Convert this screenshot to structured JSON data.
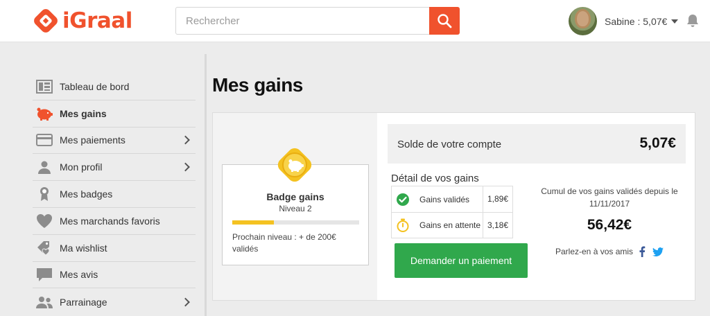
{
  "header": {
    "logo_text": "iGraal",
    "search_placeholder": "Rechercher",
    "user_label": "Sabine : 5,07€"
  },
  "sidebar": {
    "items": [
      {
        "label": "Tableau de bord",
        "icon": "dashboard-icon"
      },
      {
        "label": "Mes gains",
        "icon": "piggy-bank-icon",
        "active": true
      },
      {
        "label": "Mes paiements",
        "icon": "credit-card-icon",
        "has_arrow": true
      },
      {
        "label": "Mon profil",
        "icon": "user-icon",
        "has_arrow": true
      },
      {
        "label": "Mes badges",
        "icon": "badge-icon"
      },
      {
        "label": "Mes marchands favoris",
        "icon": "heart-icon"
      },
      {
        "label": "Ma wishlist",
        "icon": "wishlist-tag-icon"
      },
      {
        "label": "Mes avis",
        "icon": "comment-icon"
      },
      {
        "label": "Parrainage",
        "icon": "referral-icon",
        "has_arrow": true
      }
    ]
  },
  "main": {
    "title": "Mes gains",
    "badge": {
      "title": "Badge gains",
      "level": "Niveau 2",
      "progress": 0.33,
      "next_level": "Prochain niveau : + de 200€ validés"
    },
    "balance": {
      "label": "Solde de votre compte",
      "value": "5,07€"
    },
    "detail": {
      "title": "Détail de vos gains",
      "rows": [
        {
          "label": "Gains validés",
          "value": "1,89€",
          "icon": "check-circle-icon"
        },
        {
          "label": "Gains en attente",
          "value": "3,18€",
          "icon": "stopwatch-icon"
        }
      ]
    },
    "pay_button": "Demander un paiement",
    "cumul": {
      "text": "Cumul de vos gains validés depuis le 11/11/2017",
      "value": "56,42€"
    },
    "share_text": "Parlez-en à vos amis"
  },
  "colors": {
    "brand": "#f0522d",
    "success": "#30a84c",
    "badge_gold": "#f4c221",
    "facebook": "#3b5998",
    "twitter": "#1da1f2"
  }
}
